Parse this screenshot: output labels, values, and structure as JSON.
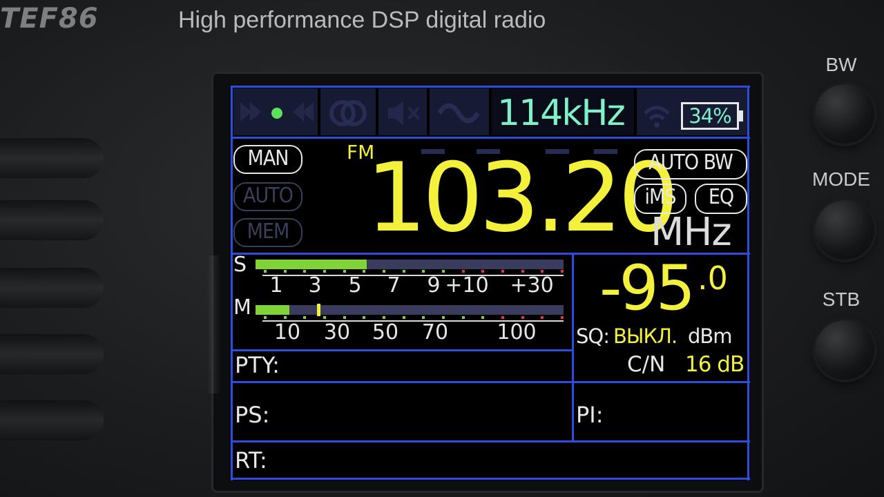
{
  "device": {
    "brand": "TEF86",
    "tagline": "High performance DSP digital radio",
    "buttons": [
      {
        "label": "BW"
      },
      {
        "label": "MODE"
      },
      {
        "label": "STB"
      }
    ]
  },
  "screen": {
    "bandwidth": "114kHz",
    "battery_percent": "34%",
    "battery_level": 0.34,
    "band": "FM",
    "frequency": "103.20",
    "unit": "MHz",
    "tuning_modes": {
      "man": "MAN",
      "auto": "AUTO",
      "mem": "MEM"
    },
    "options": {
      "auto_bw": "AUTO BW",
      "ims": "iMS",
      "eq": "EQ"
    },
    "s_meter": {
      "label": "S",
      "scale": [
        "1",
        "3",
        "5",
        "7",
        "9",
        "+10",
        "+30"
      ],
      "level": 0.36
    },
    "m_meter": {
      "label": "M",
      "scale": [
        "10",
        "30",
        "50",
        "70",
        "100"
      ],
      "level": 0.11,
      "peak": 0.2
    },
    "signal": {
      "value": "-95",
      "decimal": ".0",
      "unit": "dBm"
    },
    "squelch": {
      "label": "SQ:",
      "value": "ВЫКЛ."
    },
    "cn": {
      "label": "C/N",
      "value": "16 dB"
    },
    "rds": {
      "pty": "PTY:",
      "ps": "PS:",
      "pi": "PI:",
      "rt": "RT:"
    },
    "colors": {
      "yellow": "#f4f13c",
      "cyan": "#7ff0c8",
      "border": "#2d4de0",
      "green": "#80d43a"
    }
  }
}
